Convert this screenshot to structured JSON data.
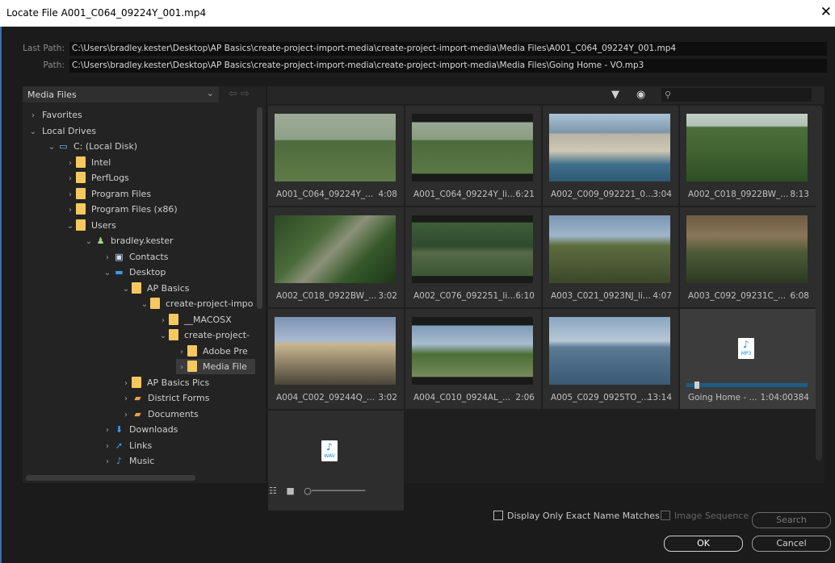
{
  "window": {
    "title": "Locate File A001_C064_09224Y_001.mp4"
  },
  "paths": {
    "last_label": "Last Path:",
    "last_value": "C:\\Users\\bradley.kester\\Desktop\\AP Basics\\create-project-import-media\\create-project-import-media\\Media Files\\A001_C064_09224Y_001.mp4",
    "path_label": "Path:",
    "path_value": "C:\\Users\\bradley.kester\\Desktop\\AP Basics\\create-project-import-media\\create-project-import-media\\Media Files\\Going Home - VO.mp3"
  },
  "browser": {
    "location": "Media Files",
    "search_placeholder": ""
  },
  "tree": [
    {
      "label": "Favorites",
      "chev": "›",
      "icon": "none"
    },
    {
      "label": "Local Drives",
      "chev": "⌄",
      "icon": "none"
    },
    {
      "label": "C: (Local Disk)",
      "chev": "⌄",
      "icon": "drive-icon"
    },
    {
      "label": "Intel",
      "chev": "›",
      "icon": "folder-icon"
    },
    {
      "label": "PerfLogs",
      "chev": "›",
      "icon": "folder-icon"
    },
    {
      "label": "Program Files",
      "chev": "›",
      "icon": "folder-icon"
    },
    {
      "label": "Program Files (x86)",
      "chev": "›",
      "icon": "folder-icon"
    },
    {
      "label": "Users",
      "chev": "⌄",
      "icon": "folder-icon"
    },
    {
      "label": "bradley.kester",
      "chev": "⌄",
      "icon": "user-icon"
    },
    {
      "label": "Contacts",
      "chev": "›",
      "icon": "contacts-icon"
    },
    {
      "label": "Desktop",
      "chev": "⌄",
      "icon": "desktop-icon"
    },
    {
      "label": "AP Basics",
      "chev": "⌄",
      "icon": "folder-icon"
    },
    {
      "label": "create-project-impo",
      "chev": "⌄",
      "icon": "folder-icon"
    },
    {
      "label": "__MACOSX",
      "chev": "›",
      "icon": "folder-icon"
    },
    {
      "label": "create-project-",
      "chev": "⌄",
      "icon": "folder-icon"
    },
    {
      "label": "Adobe Pre",
      "chev": "›",
      "icon": "folder-icon"
    },
    {
      "label": "Media File",
      "chev": "›",
      "icon": "folder-icon"
    },
    {
      "label": "AP Basics Pics",
      "chev": "›",
      "icon": "folder-icon"
    },
    {
      "label": "District Forms",
      "chev": "›",
      "icon": "shortcut-icon"
    },
    {
      "label": "Documents",
      "chev": "›",
      "icon": "shortcut-icon"
    },
    {
      "label": "Downloads",
      "chev": "›",
      "icon": "downloads-icon"
    },
    {
      "label": "Links",
      "chev": "›",
      "icon": "links-icon"
    },
    {
      "label": "Music",
      "chev": "›",
      "icon": "music-icon"
    }
  ],
  "media": [
    {
      "name": "A001_C064_09224Y_...",
      "duration": "4:08",
      "thumb": "soccer"
    },
    {
      "name": "A001_C064_09224Y_li...",
      "duration": "6:21",
      "thumb": "soccer2"
    },
    {
      "name": "A002_C009_092221_0...",
      "duration": "3:04",
      "thumb": "town"
    },
    {
      "name": "A002_C018_0922BW_...",
      "duration": "8:13",
      "thumb": "jungle"
    },
    {
      "name": "A002_C018_0922BW_...",
      "duration": "3:02",
      "thumb": "ruins"
    },
    {
      "name": "A002_C076_092251_li...",
      "duration": "6:10",
      "thumb": "field"
    },
    {
      "name": "A003_C021_0923NJ_li...",
      "duration": "4:07",
      "thumb": "hut"
    },
    {
      "name": "A003_C092_09231C_...",
      "duration": "6:08",
      "thumb": "hut2"
    },
    {
      "name": "A004_C002_09244Q_...",
      "duration": "3:02",
      "thumb": "arch"
    },
    {
      "name": "A004_C010_0924AL_...",
      "duration": "2:06",
      "thumb": "tree"
    },
    {
      "name": "A005_C029_0925TO_...",
      "duration": "13:14",
      "thumb": "lake"
    },
    {
      "name": "Going Home - ...",
      "duration": "1:04:00384",
      "thumb": "mp3",
      "file_tag": "MP3"
    },
    {
      "name": "",
      "duration": "",
      "thumb": "wav",
      "file_tag": "WAV"
    }
  ],
  "options": {
    "exact_match": "Display Only Exact Name Matches",
    "image_sequence": "Image Sequence"
  },
  "buttons": {
    "search": "Search",
    "ok": "OK",
    "cancel": "Cancel"
  }
}
